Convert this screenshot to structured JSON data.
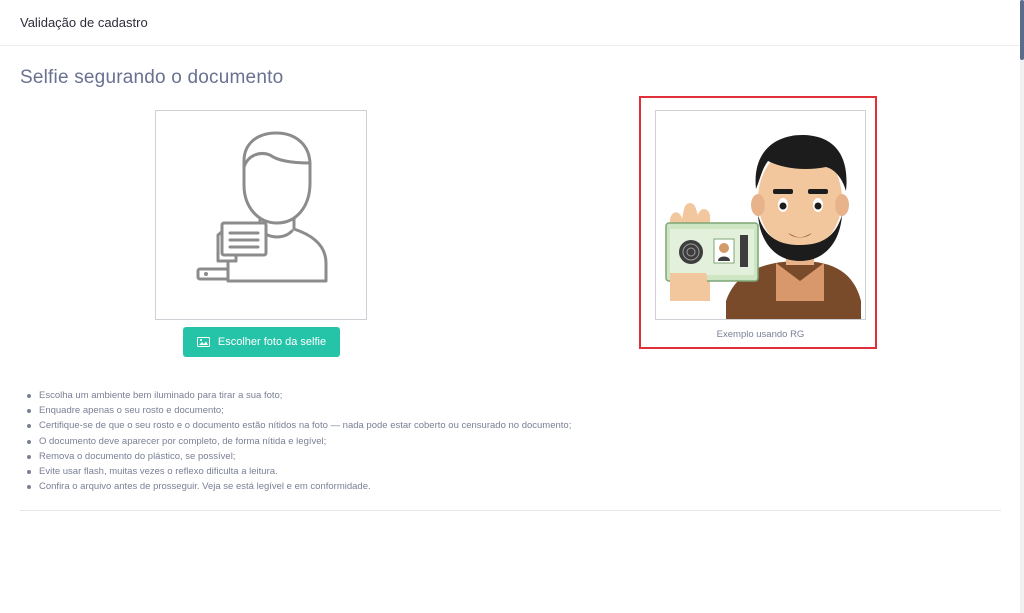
{
  "header": {
    "title": "Validação de cadastro"
  },
  "section": {
    "title": "Selfie segurando o documento"
  },
  "upload": {
    "button_label": "Escolher foto da selfie",
    "button_icon": "image-icon",
    "placeholder_icon": "person-with-document-icon"
  },
  "example": {
    "caption": "Exemplo usando RG",
    "highlight_color": "#e0313a"
  },
  "tips": [
    "Escolha um ambiente bem iluminado para tirar a sua foto;",
    "Enquadre apenas o seu rosto e documento;",
    "Certifique-se de que o seu rosto e o documento estão nítidos na foto — nada pode estar coberto ou censurado no documento;",
    "O documento deve aparecer por completo, de forma nítida e legível;",
    "Remova o documento do plástico, se possível;",
    "Evite usar flash, muitas vezes o reflexo dificulta a leitura.",
    "Confira o arquivo antes de prosseguir. Veja se está legível e em conformidade."
  ],
  "colors": {
    "accent": "#25c3a8",
    "title": "#6a7190",
    "text": "#7a7f95"
  }
}
